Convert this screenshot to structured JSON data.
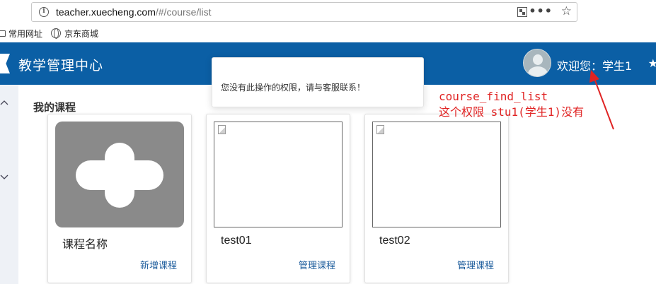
{
  "browser": {
    "url_host": "teacher.xuecheng.com",
    "url_path": "/#/course/list",
    "bookmarks": [
      {
        "label": "常用网址",
        "icon": "folder-icon"
      },
      {
        "label": "京东商城",
        "icon": "globe-icon"
      }
    ]
  },
  "header": {
    "title": "教学管理中心",
    "welcome": "欢迎您：学生1",
    "star_glyph": "★"
  },
  "main": {
    "section_title": "我的课程",
    "cards": [
      {
        "name": "课程名称",
        "link": "新增课程",
        "thumb": "plus-icon"
      },
      {
        "name": "test01",
        "link": "管理课程",
        "thumb": "broken-image-icon"
      },
      {
        "name": "test02",
        "link": "管理课程",
        "thumb": "broken-image-icon"
      }
    ]
  },
  "toast": {
    "message": "您没有此操作的权限，请与客服联系！"
  },
  "annotation": {
    "line1": "course_find_list",
    "line2": "这个权限 stu1(学生1)没有"
  },
  "colors": {
    "header_bg": "#0b5fa5",
    "annotation": "#e02323",
    "link": "#1c5c9c"
  }
}
